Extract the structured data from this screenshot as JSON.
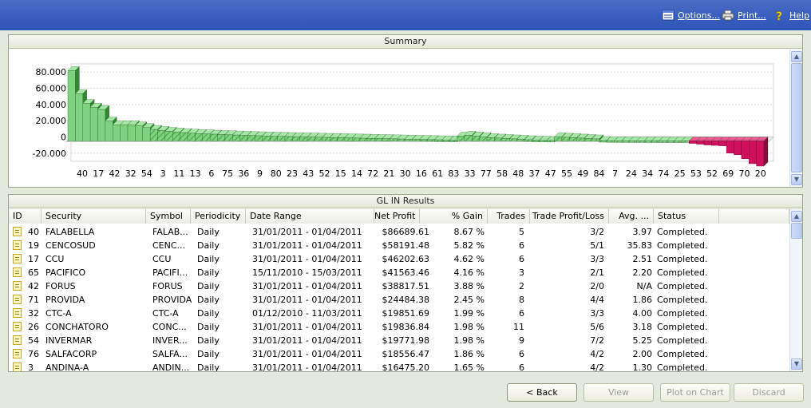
{
  "toolbar": {
    "options_label": "Options...",
    "print_label": "Print...",
    "help_label": "Help"
  },
  "summary": {
    "title": "Summary"
  },
  "chart_data": {
    "type": "bar",
    "title": "",
    "ylim": [
      -30000,
      90000
    ],
    "yticks": [
      "80.000",
      "60.000",
      "40.000",
      "20.000",
      "0",
      "-20.000"
    ],
    "xticks": [
      "40",
      "17",
      "42",
      "32",
      "54",
      "3",
      "11",
      "13",
      "6",
      "75",
      "36",
      "9",
      "80",
      "23",
      "43",
      "52",
      "15",
      "14",
      "72",
      "21",
      "30",
      "16",
      "61",
      "83",
      "33",
      "77",
      "58",
      "48",
      "37",
      "47",
      "55",
      "49",
      "84",
      "7",
      "24",
      "34",
      "74",
      "25",
      "53",
      "52",
      "69",
      "70",
      "20"
    ],
    "values": [
      86690,
      58191,
      46203,
      41564,
      38818,
      24484,
      19852,
      19837,
      19772,
      18556,
      16475,
      14200,
      12900,
      11800,
      10900,
      10200,
      9600,
      9100,
      8700,
      8300,
      7900,
      7600,
      7300,
      7000,
      6700,
      6400,
      6100,
      5800,
      5600,
      5400,
      5200,
      5000,
      4800,
      4600,
      4400,
      4200,
      4000,
      3800,
      3600,
      3400,
      3200,
      3000,
      2800,
      2600,
      2400,
      2200,
      2000,
      1800,
      1600,
      1400,
      1200,
      1000,
      6000,
      7000,
      6000,
      5000,
      4000,
      3500,
      3000,
      2500,
      2000,
      1500,
      1000,
      800,
      600,
      5000,
      4500,
      4000,
      3500,
      3000,
      2500,
      500,
      300,
      200,
      150,
      100,
      80,
      60,
      40,
      30,
      20,
      10,
      5,
      -3000,
      -4000,
      -5000,
      -5500,
      -6000,
      -15000,
      -17000,
      -22000,
      -28000,
      -31000
    ],
    "positive_color": "#7fd27f",
    "positive_hatch_color": "#4caa4c",
    "negative_color": "#d0105a"
  },
  "results": {
    "title": "GL IN Results",
    "columns": [
      "ID",
      "Security",
      "Symbol",
      "Periodicity",
      "Date Range",
      "Net Profit",
      "% Gain",
      "Trades",
      "Trade Profit/Loss",
      "Avg. ...",
      "Status"
    ],
    "rows": [
      {
        "id": "40",
        "security": "FALABELLA",
        "symbol": "FALAB...",
        "periodicity": "Daily",
        "date_range": "31/01/2011 - 01/04/2011",
        "net_profit": "$86689.61",
        "gain": "8.67 %",
        "trades": "5",
        "tpl": "3/2",
        "avg": "3.97",
        "status": "Completed."
      },
      {
        "id": "19",
        "security": "CENCOSUD",
        "symbol": "CENC...",
        "periodicity": "Daily",
        "date_range": "31/01/2011 - 01/04/2011",
        "net_profit": "$58191.48",
        "gain": "5.82 %",
        "trades": "6",
        "tpl": "5/1",
        "avg": "35.83",
        "status": "Completed."
      },
      {
        "id": "17",
        "security": "CCU",
        "symbol": "CCU",
        "periodicity": "Daily",
        "date_range": "31/01/2011 - 01/04/2011",
        "net_profit": "$46202.63",
        "gain": "4.62 %",
        "trades": "6",
        "tpl": "3/3",
        "avg": "2.51",
        "status": "Completed."
      },
      {
        "id": "65",
        "security": "PACIFICO",
        "symbol": "PACIFI...",
        "periodicity": "Daily",
        "date_range": "15/11/2010 - 15/03/2011",
        "net_profit": "$41563.46",
        "gain": "4.16 %",
        "trades": "3",
        "tpl": "2/1",
        "avg": "2.20",
        "status": "Completed."
      },
      {
        "id": "42",
        "security": "FORUS",
        "symbol": "FORUS",
        "periodicity": "Daily",
        "date_range": "31/01/2011 - 01/04/2011",
        "net_profit": "$38817.51",
        "gain": "3.88 %",
        "trades": "2",
        "tpl": "2/0",
        "avg": "N/A",
        "status": "Completed."
      },
      {
        "id": "71",
        "security": "PROVIDA",
        "symbol": "PROVIDA",
        "periodicity": "Daily",
        "date_range": "31/01/2011 - 01/04/2011",
        "net_profit": "$24484.38",
        "gain": "2.45 %",
        "trades": "8",
        "tpl": "4/4",
        "avg": "1.86",
        "status": "Completed."
      },
      {
        "id": "32",
        "security": "CTC-A",
        "symbol": "CTC-A",
        "periodicity": "Daily",
        "date_range": "01/12/2010 - 11/03/2011",
        "net_profit": "$19851.69",
        "gain": "1.99 %",
        "trades": "6",
        "tpl": "3/3",
        "avg": "4.00",
        "status": "Completed."
      },
      {
        "id": "26",
        "security": "CONCHATORO",
        "symbol": "CONC...",
        "periodicity": "Daily",
        "date_range": "31/01/2011 - 01/04/2011",
        "net_profit": "$19836.84",
        "gain": "1.98 %",
        "trades": "11",
        "tpl": "5/6",
        "avg": "3.18",
        "status": "Completed."
      },
      {
        "id": "54",
        "security": "INVERMAR",
        "symbol": "INVER...",
        "periodicity": "Daily",
        "date_range": "31/01/2011 - 01/04/2011",
        "net_profit": "$19771.98",
        "gain": "1.98 %",
        "trades": "9",
        "tpl": "7/2",
        "avg": "5.25",
        "status": "Completed."
      },
      {
        "id": "76",
        "security": "SALFACORP",
        "symbol": "SALFA...",
        "periodicity": "Daily",
        "date_range": "31/01/2011 - 01/04/2011",
        "net_profit": "$18556.47",
        "gain": "1.86 %",
        "trades": "6",
        "tpl": "4/2",
        "avg": "2.00",
        "status": "Completed."
      },
      {
        "id": "3",
        "security": "ANDINA-A",
        "symbol": "ANDIN...",
        "periodicity": "Daily",
        "date_range": "31/01/2011 - 01/04/2011",
        "net_profit": "$16475.20",
        "gain": "1.65 %",
        "trades": "6",
        "tpl": "4/2",
        "avg": "1.30",
        "status": "Completed."
      }
    ]
  },
  "buttons": {
    "back": "< Back",
    "view": "View",
    "plot": "Plot on Chart",
    "discard": "Discard"
  }
}
